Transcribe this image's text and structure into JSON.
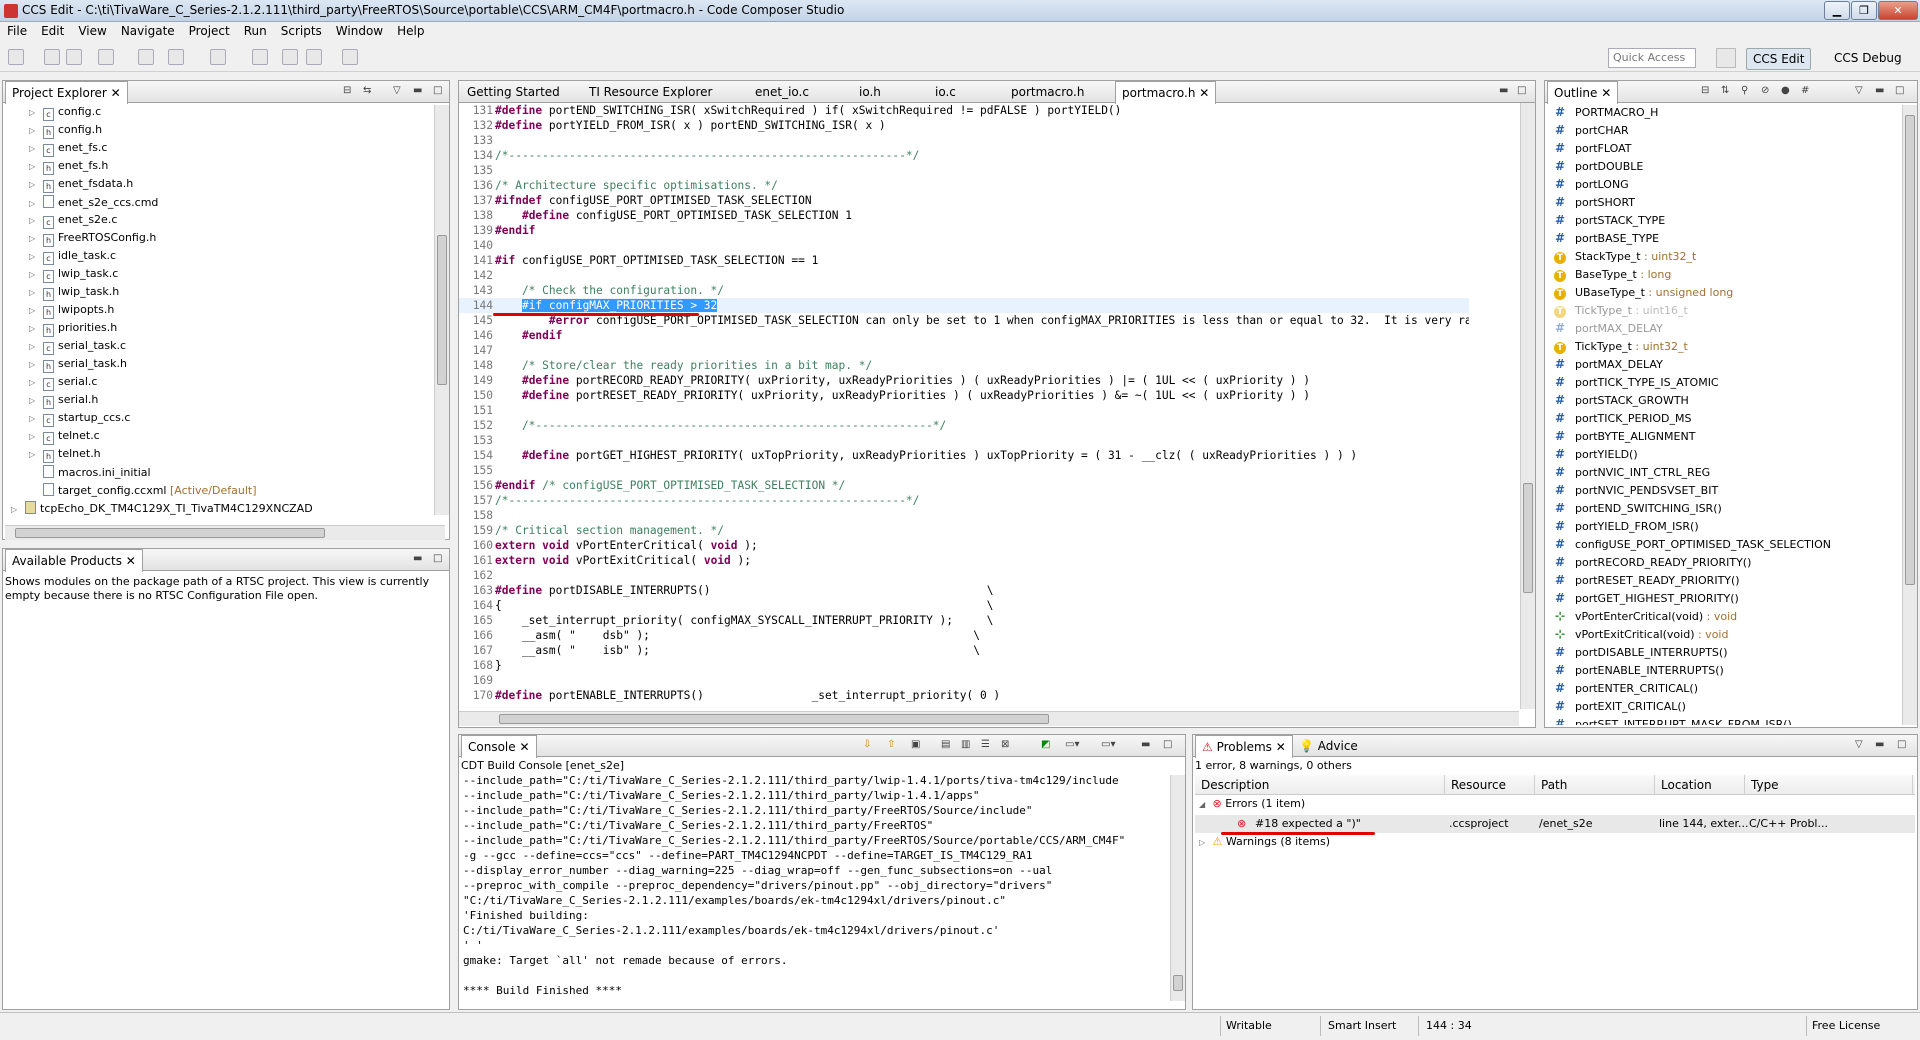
{
  "window": {
    "title": "CCS Edit - C:\\ti\\TivaWare_C_Series-2.1.2.111\\third_party\\FreeRTOS\\Source\\portable\\CCS\\ARM_CM4F\\portmacro.h - Code Composer Studio"
  },
  "menu": [
    "File",
    "Edit",
    "View",
    "Navigate",
    "Project",
    "Run",
    "Scripts",
    "Window",
    "Help"
  ],
  "toolbar": {
    "quick_access": "Quick Access"
  },
  "perspectives": {
    "edit": "CCS Edit",
    "debug": "CCS Debug"
  },
  "project_explorer": {
    "title": "Project Explorer",
    "items": [
      {
        "name": "config.c",
        "icon": "c"
      },
      {
        "name": "config.h",
        "icon": "h"
      },
      {
        "name": "enet_fs.c",
        "icon": "c"
      },
      {
        "name": "enet_fs.h",
        "icon": "h"
      },
      {
        "name": "enet_fsdata.h",
        "icon": "h"
      },
      {
        "name": "enet_s2e_ccs.cmd",
        "icon": "cmd"
      },
      {
        "name": "enet_s2e.c",
        "icon": "c"
      },
      {
        "name": "FreeRTOSConfig.h",
        "icon": "h"
      },
      {
        "name": "idle_task.c",
        "icon": "c"
      },
      {
        "name": "lwip_task.c",
        "icon": "c"
      },
      {
        "name": "lwip_task.h",
        "icon": "h"
      },
      {
        "name": "lwipopts.h",
        "icon": "h"
      },
      {
        "name": "priorities.h",
        "icon": "h"
      },
      {
        "name": "serial_task.c",
        "icon": "c"
      },
      {
        "name": "serial_task.h",
        "icon": "h"
      },
      {
        "name": "serial.c",
        "icon": "c"
      },
      {
        "name": "serial.h",
        "icon": "h"
      },
      {
        "name": "startup_ccs.c",
        "icon": "c"
      },
      {
        "name": "telnet.c",
        "icon": "c"
      },
      {
        "name": "telnet.h",
        "icon": "h"
      },
      {
        "name": "macros.ini_initial",
        "icon": "f"
      },
      {
        "name": "target_config.ccxml",
        "icon": "x",
        "suffix": "[Active/Default]"
      }
    ],
    "project": "tcpEcho_DK_TM4C129X_TI_TivaTM4C129XNCZAD"
  },
  "available_products": {
    "title": "Available Products",
    "message": "Shows modules on the package path of a RTSC project. This view is currently empty because there is no RTSC Configuration File open."
  },
  "editor": {
    "tabs": [
      "Getting Started",
      "TI Resource Explorer",
      "enet_io.c",
      "io.h",
      "io.c",
      "portmacro.h",
      "portmacro.h"
    ],
    "active_tab": 6,
    "lines": [
      {
        "n": "131",
        "t": "#define portEND_SWITCHING_ISR( xSwitchRequired ) if( xSwitchRequired != pdFALSE ) portYIELD()",
        "k": "d"
      },
      {
        "n": "132",
        "t": "#define portYIELD_FROM_ISR( x ) portEND_SWITCHING_ISR( x )",
        "k": "d"
      },
      {
        "n": "133",
        "t": "",
        "k": ""
      },
      {
        "n": "134",
        "t": "/*-----------------------------------------------------------*/",
        "k": "c"
      },
      {
        "n": "135",
        "t": "",
        "k": ""
      },
      {
        "n": "136",
        "t": "/* Architecture specific optimisations. */",
        "k": "c"
      },
      {
        "n": "137",
        "t": "#ifndef configUSE_PORT_OPTIMISED_TASK_SELECTION",
        "k": "d"
      },
      {
        "n": "138",
        "t": "    #define configUSE_PORT_OPTIMISED_TASK_SELECTION 1",
        "k": "d"
      },
      {
        "n": "139",
        "t": "#endif",
        "k": "d"
      },
      {
        "n": "140",
        "t": "",
        "k": ""
      },
      {
        "n": "141",
        "t": "#if configUSE_PORT_OPTIMISED_TASK_SELECTION == 1",
        "k": "d"
      },
      {
        "n": "142",
        "t": "",
        "k": ""
      },
      {
        "n": "143",
        "t": "    /* Check the configuration. */",
        "k": "c"
      },
      {
        "n": "144",
        "t": "    #if configMAX_PRIORITIES > 32",
        "k": "s"
      },
      {
        "n": "145",
        "t": "        #error configUSE_PORT_OPTIMISED_TASK_SELECTION can only be set to 1 when configMAX_PRIORITIES is less than or equal to 32.  It is very rar",
        "k": "d"
      },
      {
        "n": "146",
        "t": "    #endif",
        "k": "d"
      },
      {
        "n": "147",
        "t": "",
        "k": ""
      },
      {
        "n": "148",
        "t": "    /* Store/clear the ready priorities in a bit map. */",
        "k": "c"
      },
      {
        "n": "149",
        "t": "    #define portRECORD_READY_PRIORITY( uxPriority, uxReadyPriorities ) ( uxReadyPriorities ) |= ( 1UL << ( uxPriority ) )",
        "k": "d"
      },
      {
        "n": "150",
        "t": "    #define portRESET_READY_PRIORITY( uxPriority, uxReadyPriorities ) ( uxReadyPriorities ) &= ~( 1UL << ( uxPriority ) )",
        "k": "d"
      },
      {
        "n": "151",
        "t": "",
        "k": ""
      },
      {
        "n": "152",
        "t": "    /*-----------------------------------------------------------*/",
        "k": "c"
      },
      {
        "n": "153",
        "t": "",
        "k": ""
      },
      {
        "n": "154",
        "t": "    #define portGET_HIGHEST_PRIORITY( uxTopPriority, uxReadyPriorities ) uxTopPriority = ( 31 - __clz( ( uxReadyPriorities ) ) )",
        "k": "d"
      },
      {
        "n": "155",
        "t": "",
        "k": ""
      },
      {
        "n": "156",
        "t": "#endif /* configUSE_PORT_OPTIMISED_TASK_SELECTION */",
        "k": "d"
      },
      {
        "n": "157",
        "t": "/*-----------------------------------------------------------*/",
        "k": "c"
      },
      {
        "n": "158",
        "t": "",
        "k": ""
      },
      {
        "n": "159",
        "t": "/* Critical section management. */",
        "k": "c"
      },
      {
        "n": "160",
        "t": "extern void vPortEnterCritical( void );",
        "k": "d"
      },
      {
        "n": "161",
        "t": "extern void vPortExitCritical( void );",
        "k": "d"
      },
      {
        "n": "162",
        "t": "",
        "k": ""
      },
      {
        "n": "163",
        "t": "#define portDISABLE_INTERRUPTS()                                         \\",
        "k": "d"
      },
      {
        "n": "164",
        "t": "{                                                                        \\",
        "k": ""
      },
      {
        "n": "165",
        "t": "    _set_interrupt_priority( configMAX_SYSCALL_INTERRUPT_PRIORITY );     \\",
        "k": ""
      },
      {
        "n": "166",
        "t": "    __asm( \"    dsb\" );                                                \\",
        "k": ""
      },
      {
        "n": "167",
        "t": "    __asm( \"    isb\" );                                                \\",
        "k": ""
      },
      {
        "n": "168",
        "t": "}",
        "k": ""
      },
      {
        "n": "169",
        "t": "",
        "k": ""
      },
      {
        "n": "170",
        "t": "#define portENABLE_INTERRUPTS()                _set_interrupt_priority( 0 )",
        "k": "d"
      }
    ]
  },
  "outline": {
    "title": "Outline",
    "items": [
      {
        "name": "PORTMACRO_H",
        "type": "",
        "icon": "hash"
      },
      {
        "name": "portCHAR",
        "type": "",
        "icon": "hash"
      },
      {
        "name": "portFLOAT",
        "type": "",
        "icon": "hash"
      },
      {
        "name": "portDOUBLE",
        "type": "",
        "icon": "hash"
      },
      {
        "name": "portLONG",
        "type": "",
        "icon": "hash"
      },
      {
        "name": "portSHORT",
        "type": "",
        "icon": "hash"
      },
      {
        "name": "portSTACK_TYPE",
        "type": "",
        "icon": "hash"
      },
      {
        "name": "portBASE_TYPE",
        "type": "",
        "icon": "hash"
      },
      {
        "name": "StackType_t",
        "type": " : uint32_t",
        "icon": "typedef"
      },
      {
        "name": "BaseType_t",
        "type": " : long",
        "icon": "typedef"
      },
      {
        "name": "UBaseType_t",
        "type": " : unsigned long",
        "icon": "typedef"
      },
      {
        "name": "TickType_t",
        "type": " : uint16_t",
        "icon": "typedef-dim"
      },
      {
        "name": "portMAX_DELAY",
        "type": "",
        "icon": "hash-dim"
      },
      {
        "name": "TickType_t",
        "type": " : uint32_t",
        "icon": "typedef"
      },
      {
        "name": "portMAX_DELAY",
        "type": "",
        "icon": "hash"
      },
      {
        "name": "portTICK_TYPE_IS_ATOMIC",
        "type": "",
        "icon": "hash"
      },
      {
        "name": "portSTACK_GROWTH",
        "type": "",
        "icon": "hash"
      },
      {
        "name": "portTICK_PERIOD_MS",
        "type": "",
        "icon": "hash"
      },
      {
        "name": "portBYTE_ALIGNMENT",
        "type": "",
        "icon": "hash"
      },
      {
        "name": "portYIELD()",
        "type": "",
        "icon": "hash"
      },
      {
        "name": "portNVIC_INT_CTRL_REG",
        "type": "",
        "icon": "hash"
      },
      {
        "name": "portNVIC_PENDSVSET_BIT",
        "type": "",
        "icon": "hash"
      },
      {
        "name": "portEND_SWITCHING_ISR()",
        "type": "",
        "icon": "hash"
      },
      {
        "name": "portYIELD_FROM_ISR()",
        "type": "",
        "icon": "hash"
      },
      {
        "name": "configUSE_PORT_OPTIMISED_TASK_SELECTION",
        "type": "",
        "icon": "hash"
      },
      {
        "name": "portRECORD_READY_PRIORITY()",
        "type": "",
        "icon": "hash"
      },
      {
        "name": "portRESET_READY_PRIORITY()",
        "type": "",
        "icon": "hash"
      },
      {
        "name": "portGET_HIGHEST_PRIORITY()",
        "type": "",
        "icon": "hash"
      },
      {
        "name": "vPortEnterCritical(void)",
        "type": " : void",
        "icon": "func"
      },
      {
        "name": "vPortExitCritical(void)",
        "type": " : void",
        "icon": "func"
      },
      {
        "name": "portDISABLE_INTERRUPTS()",
        "type": "",
        "icon": "hash"
      },
      {
        "name": "portENABLE_INTERRUPTS()",
        "type": "",
        "icon": "hash"
      },
      {
        "name": "portENTER_CRITICAL()",
        "type": "",
        "icon": "hash"
      },
      {
        "name": "portEXIT_CRITICAL()",
        "type": "",
        "icon": "hash"
      },
      {
        "name": "portSET_INTERRUPT_MASK_FROM_ISR()",
        "type": "",
        "icon": "hash"
      }
    ]
  },
  "console": {
    "title": "Console",
    "subtitle": "CDT Build Console [enet_s2e]",
    "lines": [
      "--include_path=\"C:/ti/TivaWare_C_Series-2.1.2.111/third_party/lwip-1.4.1/ports/tiva-tm4c129/include",
      "--include_path=\"C:/ti/TivaWare_C_Series-2.1.2.111/third_party/lwip-1.4.1/apps\"",
      "--include_path=\"C:/ti/TivaWare_C_Series-2.1.2.111/third_party/FreeRTOS/Source/include\"",
      "--include_path=\"C:/ti/TivaWare_C_Series-2.1.2.111/third_party/FreeRTOS\"",
      "--include_path=\"C:/ti/TivaWare_C_Series-2.1.2.111/third_party/FreeRTOS/Source/portable/CCS/ARM_CM4F\"",
      "-g --gcc --define=ccs=\"ccs\" --define=PART_TM4C1294NCPDT --define=TARGET_IS_TM4C129_RA1",
      "--display_error_number --diag_warning=225 --diag_wrap=off --gen_func_subsections=on --ual",
      "--preproc_with_compile --preproc_dependency=\"drivers/pinout.pp\" --obj_directory=\"drivers\"",
      "\"C:/ti/TivaWare_C_Series-2.1.2.111/examples/boards/ek-tm4c1294xl/drivers/pinout.c\"",
      "'Finished building:",
      "C:/ti/TivaWare_C_Series-2.1.2.111/examples/boards/ek-tm4c1294xl/drivers/pinout.c'",
      "' '",
      "gmake: Target `all' not remade because of errors.",
      "",
      "**** Build Finished ****"
    ]
  },
  "problems": {
    "tabs": [
      "Problems",
      "Advice"
    ],
    "summary": "1 error, 8 warnings, 0 others",
    "columns": [
      "Description",
      "Resource",
      "Path",
      "Location",
      "Type"
    ],
    "errors_group": "Errors (1 item)",
    "error": {
      "description": "#18 expected a \")\"",
      "resource": ".ccsproject",
      "path": "/enet_s2e",
      "location": "line 144, exter...",
      "type": "C/C++ Probl..."
    },
    "warnings_group": "Warnings (8 items)"
  },
  "status": {
    "writable": "Writable",
    "insert": "Smart Insert",
    "position": "144 : 34",
    "license": "Free License"
  },
  "colors": {
    "keyword": "#7f0055",
    "comment": "#3f7f5f",
    "selection": "#3399ff",
    "error_underline": "#e00000"
  }
}
